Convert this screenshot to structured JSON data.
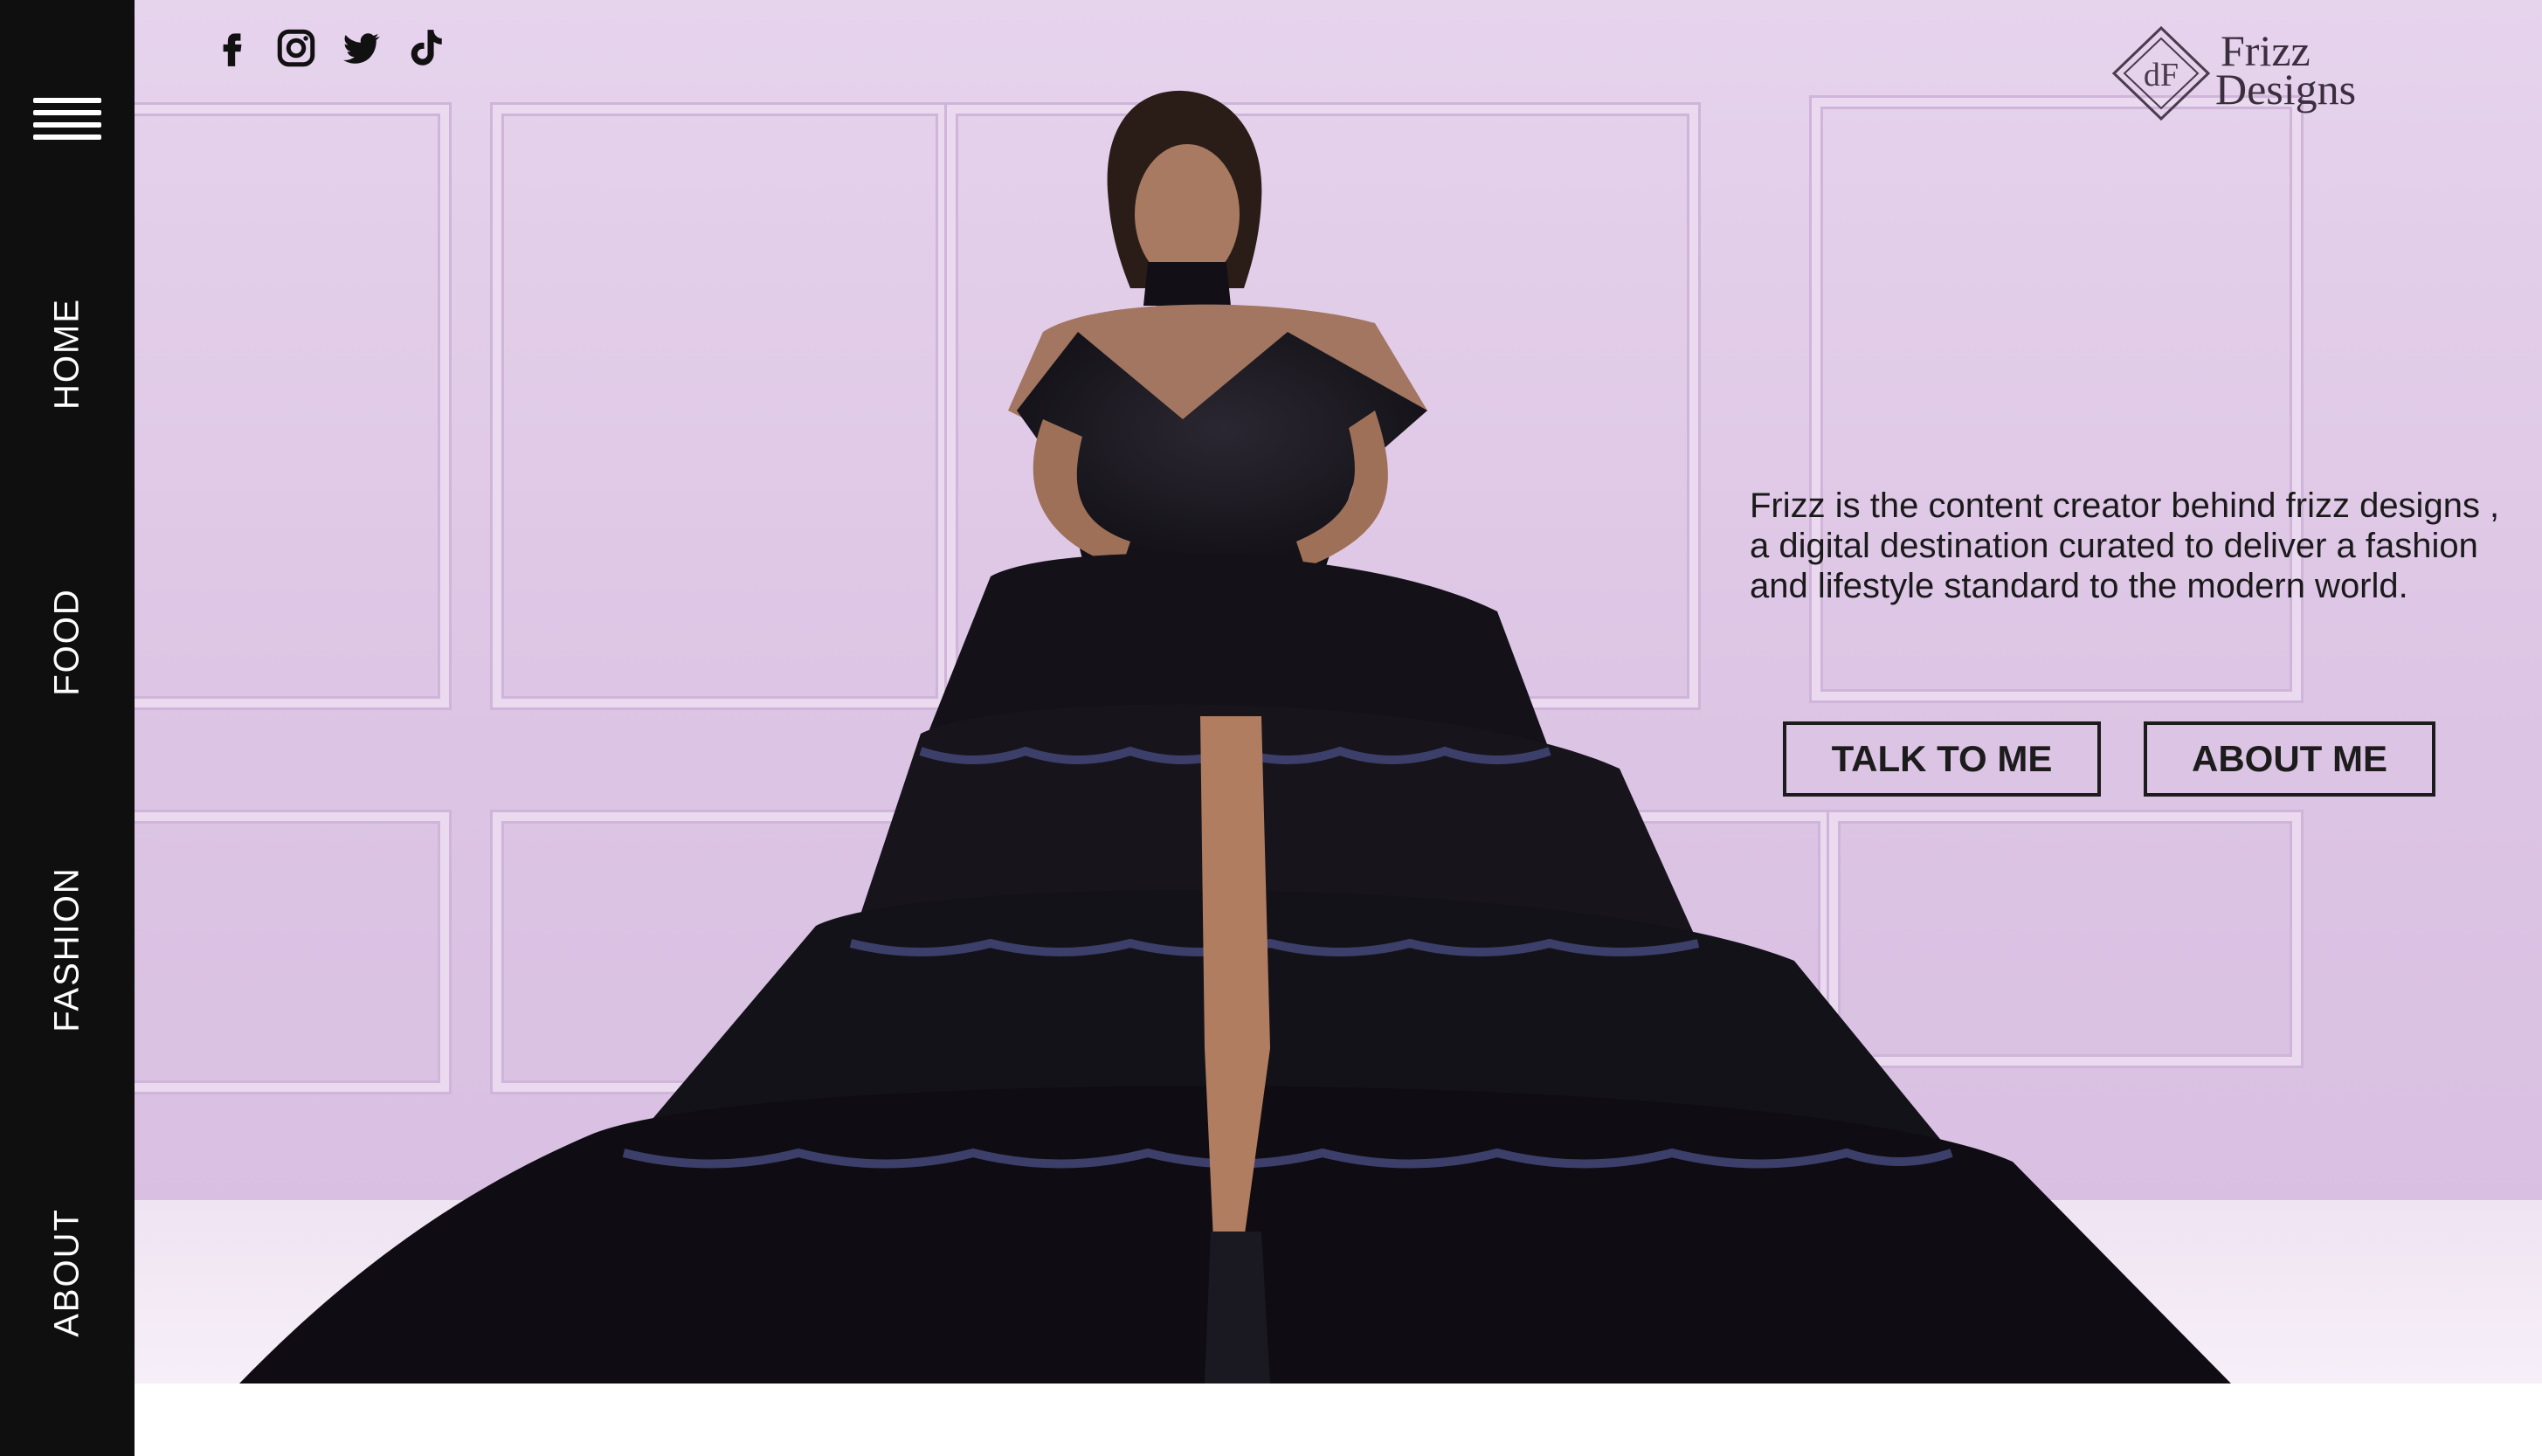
{
  "nav": {
    "menu_icon": "hamburger-menu-icon",
    "items": [
      {
        "label": "HOME"
      },
      {
        "label": "FOOD"
      },
      {
        "label": "FASHION"
      },
      {
        "label": "ABOUT"
      }
    ]
  },
  "social": {
    "icons": [
      "facebook-icon",
      "instagram-icon",
      "twitter-icon",
      "tiktok-icon"
    ]
  },
  "logo": {
    "line1": "Frizz",
    "line2": "Designs",
    "monogram": "dF"
  },
  "hero": {
    "intro": "Frizz is the content creator behind frizz designs , a digital destination curated to deliver a fashion and lifestyle standard to the modern world.",
    "talk_button": "TALK TO ME",
    "about_button": "ABOUT ME"
  },
  "colors": {
    "sidebar": "#0f0f10",
    "hero_background": "#e6d3ec",
    "text": "#1a1a1a"
  }
}
